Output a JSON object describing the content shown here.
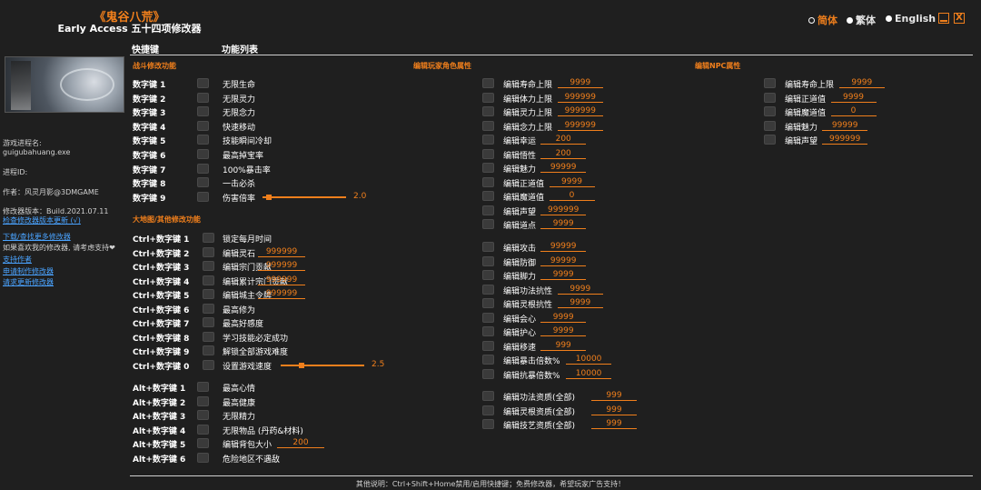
{
  "header": {
    "game_title": "《鬼谷八荒》",
    "subtitle": "Early Access 五十四项修改器",
    "lang_simplified": "简体",
    "lang_traditional": "繁体",
    "lang_english": "English",
    "minimize_icon": "minimize-icon",
    "close_icon": "close-icon",
    "close_glyph": "X"
  },
  "tabs": {
    "hotkeys": "快捷键",
    "features": "功能列表"
  },
  "sidebar": {
    "process_label": "游戏进程名:",
    "process_name": "guigubahuang.exe",
    "pid_label": "进程ID:",
    "author": "作者：风灵月影@3DMGAME",
    "version": "修改器版本：Build.2021.07.11",
    "check_update": "检查修改器版本更新 (√)",
    "download_more": "下载/查找更多修改器",
    "support_note": "如果喜欢我的修改器, 请考虑支持❤",
    "support_author": "支持作者",
    "request_trainer": "申请制作修改器",
    "request_update": "请求更新修改器"
  },
  "sections": {
    "combat": "战斗修改功能",
    "world": "大地图/其他修改功能",
    "player": "编辑玩家角色属性",
    "npc": "编辑NPC属性"
  },
  "combat_rows": [
    {
      "key": "数字键 1",
      "label": "无限生命"
    },
    {
      "key": "数字键 2",
      "label": "无限灵力"
    },
    {
      "key": "数字键 3",
      "label": "无限念力"
    },
    {
      "key": "数字键 4",
      "label": "快速移动"
    },
    {
      "key": "数字键 5",
      "label": "技能瞬间冷却"
    },
    {
      "key": "数字键 6",
      "label": "最高掉宝率"
    },
    {
      "key": "数字键 7",
      "label": "100%暴击率"
    },
    {
      "key": "数字键 8",
      "label": "一击必杀"
    },
    {
      "key": "数字键 9",
      "label": "伤害倍率",
      "slider": "2.0",
      "slider_fraction": 0.08
    }
  ],
  "world_rows": [
    {
      "key": "Ctrl+数字键 1",
      "label": "锁定每月时间"
    },
    {
      "key": "Ctrl+数字键 2",
      "label": "编辑灵石",
      "value": "999999"
    },
    {
      "key": "Ctrl+数字键 3",
      "label": "编辑宗门贡献",
      "value": "999999"
    },
    {
      "key": "Ctrl+数字键 4",
      "label": "编辑累计宗门贡献",
      "value": "999999"
    },
    {
      "key": "Ctrl+数字键 5",
      "label": "编辑城主令牌",
      "value": "999999"
    },
    {
      "key": "Ctrl+数字键 6",
      "label": "最高修为"
    },
    {
      "key": "Ctrl+数字键 7",
      "label": "最高好感度"
    },
    {
      "key": "Ctrl+数字键 8",
      "label": "学习技能必定成功"
    },
    {
      "key": "Ctrl+数字键 9",
      "label": "解锁全部游戏难度"
    },
    {
      "key": "Ctrl+数字键 0",
      "label": "设置游戏速度",
      "slider": "2.5",
      "slider_fraction": 0.25
    }
  ],
  "alt_rows": [
    {
      "key": "Alt+数字键 1",
      "label": "最高心情"
    },
    {
      "key": "Alt+数字键 2",
      "label": "最高健康"
    },
    {
      "key": "Alt+数字键 3",
      "label": "无限精力"
    },
    {
      "key": "Alt+数字键 4",
      "label": "无限物品 (丹药&材料)"
    },
    {
      "key": "Alt+数字键 5",
      "label": "编辑背包大小",
      "value": "200"
    },
    {
      "key": "Alt+数字键 6",
      "label": "危险地区不遇敌"
    }
  ],
  "player_groups": [
    [
      {
        "label": "编辑寿命上限",
        "value": "9999"
      },
      {
        "label": "编辑体力上限",
        "value": "999999"
      },
      {
        "label": "编辑灵力上限",
        "value": "999999"
      },
      {
        "label": "编辑念力上限",
        "value": "999999"
      },
      {
        "label": "编辑幸运",
        "value": "200"
      },
      {
        "label": "编辑悟性",
        "value": "200"
      },
      {
        "label": "编辑魅力",
        "value": "99999"
      },
      {
        "label": "编辑正道值",
        "value": "9999"
      },
      {
        "label": "编辑魔道值",
        "value": "0"
      },
      {
        "label": "编辑声望",
        "value": "999999"
      },
      {
        "label": "编辑道点",
        "value": "9999"
      }
    ],
    [
      {
        "label": "编辑攻击",
        "value": "99999"
      },
      {
        "label": "编辑防御",
        "value": "99999"
      },
      {
        "label": "编辑脚力",
        "value": "9999"
      },
      {
        "label": "编辑功法抗性",
        "value": "9999"
      },
      {
        "label": "编辑灵根抗性",
        "value": "9999"
      },
      {
        "label": "编辑会心",
        "value": "9999"
      },
      {
        "label": "编辑护心",
        "value": "9999"
      },
      {
        "label": "编辑移速",
        "value": "999"
      },
      {
        "label": "编辑暴击倍数%",
        "value": "10000"
      },
      {
        "label": "编辑抗暴倍数%",
        "value": "10000"
      }
    ],
    [
      {
        "label": "编辑功法资质(全部)",
        "value": "999"
      },
      {
        "label": "编辑灵根资质(全部)",
        "value": "999"
      },
      {
        "label": "编辑技艺资质(全部)",
        "value": "999"
      }
    ]
  ],
  "npc_rows": [
    {
      "label": "编辑寿命上限",
      "value": "9999"
    },
    {
      "label": "编辑正道值",
      "value": "9999"
    },
    {
      "label": "编辑魔道值",
      "value": "0"
    },
    {
      "label": "编辑魅力",
      "value": "99999"
    },
    {
      "label": "编辑声望",
      "value": "999999"
    }
  ],
  "footer": "其他说明：Ctrl+Shift+Home禁用/启用快捷键；免费修改器，希望玩家广告支持！"
}
